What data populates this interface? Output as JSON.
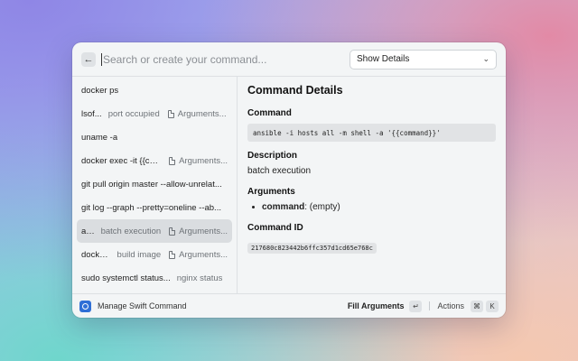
{
  "search": {
    "placeholder": "Search or create your command...",
    "dropdown_value": "Show Details"
  },
  "list": [
    {
      "title": "docker ps",
      "subtitle": "",
      "accessory": ""
    },
    {
      "title": "lsof...",
      "subtitle": "port occupied",
      "accessory": "Arguments..."
    },
    {
      "title": "uname -a",
      "subtitle": "",
      "accessory": ""
    },
    {
      "title": "docker exec -it {{co...",
      "subtitle": "",
      "accessory": "Arguments..."
    },
    {
      "title": "git pull origin master --allow-unrelat...",
      "subtitle": "",
      "accessory": ""
    },
    {
      "title": "git log --graph --pretty=oneline --ab...",
      "subtitle": "",
      "accessory": ""
    },
    {
      "title": "an...",
      "subtitle": "batch execution",
      "accessory": "Arguments...",
      "selected": true
    },
    {
      "title": "docke...",
      "subtitle": "build image",
      "accessory": "Arguments..."
    },
    {
      "title": "sudo systemctl status...",
      "subtitle": "nginx status",
      "accessory": ""
    }
  ],
  "details": {
    "heading": "Command Details",
    "command_label": "Command",
    "command": "ansible -i hosts all -m shell -a '{{command}}'",
    "description_label": "Description",
    "description": "batch execution",
    "arguments_label": "Arguments",
    "argument_name": "command",
    "argument_value": ": (empty)",
    "id_label": "Command ID",
    "id": "217680c823442b6ffc357d1cd65e768c"
  },
  "footer": {
    "app_name": "Manage Swift Command",
    "fill_arguments": "Fill Arguments",
    "enter_key": "↵",
    "actions": "Actions",
    "cmd_key": "⌘",
    "k_key": "K"
  },
  "colors": {
    "accent": "#2f6fd6",
    "selected_row": "#dadde0"
  },
  "icons": {
    "back": "arrow-left-icon",
    "dropdown": "chevron-down-icon",
    "argument": "document-icon",
    "app": "app-logo-icon"
  }
}
